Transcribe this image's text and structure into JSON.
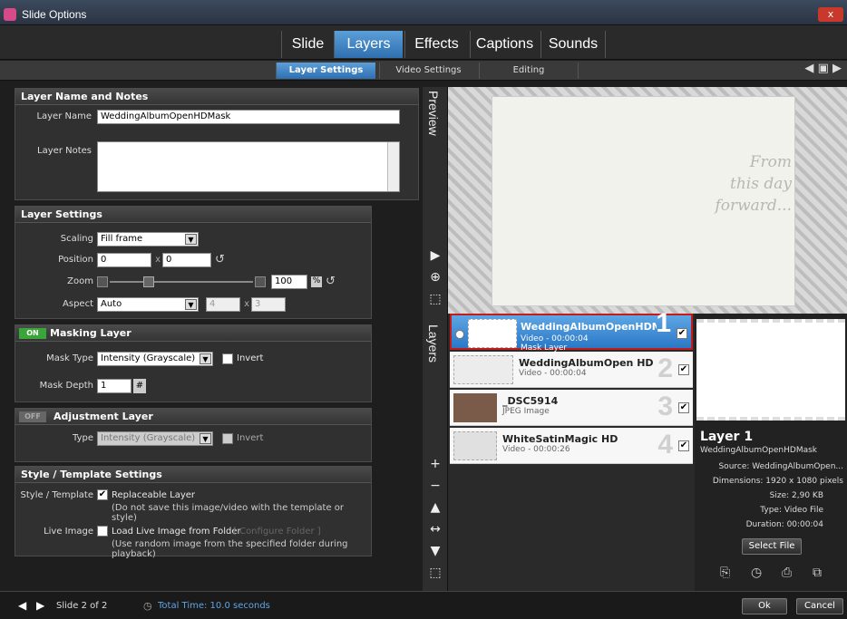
{
  "window": {
    "title": "Slide Options",
    "close_label": "x"
  },
  "main_tabs": [
    "Slide",
    "Layers",
    "Effects",
    "Captions",
    "Sounds"
  ],
  "sub_tabs": [
    "Layer Settings",
    "Video Settings",
    "Editing"
  ],
  "layer_name_panel": {
    "title": "Layer Name and Notes",
    "name_label": "Layer Name",
    "name_value": "WeddingAlbumOpenHDMask",
    "notes_label": "Layer Notes",
    "notes_value": ""
  },
  "layer_settings": {
    "title": "Layer Settings",
    "scaling_label": "Scaling",
    "scaling_value": "Fill frame",
    "position_label": "Position",
    "position_x": "0",
    "position_y": "0",
    "x_sep": "x",
    "zoom_label": "Zoom",
    "zoom_value": "100",
    "zoom_unit": "%",
    "zoom_level": 0.25,
    "aspect_label": "Aspect",
    "aspect_value": "Auto",
    "aspect_w": "4",
    "aspect_h": "3"
  },
  "masking_layer": {
    "title": "Masking Layer",
    "toggle": "ON",
    "mask_type_label": "Mask Type",
    "mask_type_value": "Intensity (Grayscale)",
    "invert_label": "Invert",
    "mask_depth_label": "Mask Depth",
    "mask_depth_value": "1",
    "mask_depth_suffix": "#"
  },
  "adjustment_layer": {
    "title": "Adjustment Layer",
    "toggle": "OFF",
    "type_label": "Type",
    "type_value": "Intensity (Grayscale)",
    "invert_label": "Invert"
  },
  "style_template": {
    "title": "Style / Template Settings",
    "style_label": "Style / Template",
    "replaceable_label": "Replaceable Layer",
    "replaceable_note": "(Do not save this image/video with the template or style)",
    "live_image_label": "Live Image",
    "load_label": "Load Live Image from Folder",
    "configure_label": "[ Configure Folder ]",
    "live_note": "(Use random image from the specified folder during playback)"
  },
  "sidebar": {
    "preview_label": "Preview",
    "layers_label": "Layers"
  },
  "preview": {
    "text_lines": [
      "From",
      "this day",
      "forward..."
    ]
  },
  "layers": [
    {
      "name": "WeddingAlbumOpenHDMa...",
      "sub": "Video - 00:00:04",
      "sub2": "Mask Layer",
      "num": "1",
      "selected": true
    },
    {
      "name": "WeddingAlbumOpen HD",
      "sub": "Video - 00:00:04",
      "num": "2",
      "selected": false
    },
    {
      "name": "_DSC5914",
      "sub": "JPEG Image",
      "num": "3",
      "selected": false
    },
    {
      "name": "WhiteSatinMagic HD",
      "sub": "Video - 00:00:26",
      "num": "4",
      "selected": false
    }
  ],
  "layer_info": {
    "title": "Layer 1",
    "subtitle": "WeddingAlbumOpenHDMask",
    "source": "Source: WeddingAlbumOpen...",
    "dimensions": "Dimensions: 1920 x 1080 pixels",
    "size": "Size: 2,90 KB",
    "type": "Type: Video File",
    "duration": "Duration: 00:00:04",
    "select_file": "Select File"
  },
  "footer": {
    "slide_label": "Slide 2 of 2",
    "total_time": "Total Time: 10.0 seconds",
    "ok_label": "Ok",
    "cancel_label": "Cancel"
  },
  "colors": {
    "accent": "#2f6fb0",
    "highlight": "#c41c1c",
    "toggle_on": "#3aa63a"
  }
}
